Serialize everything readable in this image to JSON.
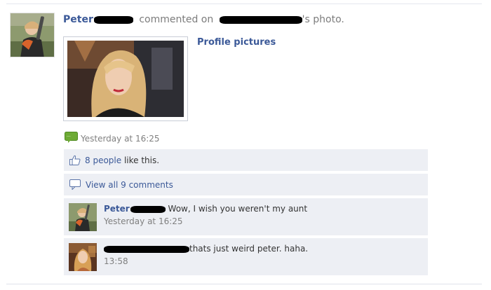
{
  "story": {
    "actor_name": "Peter",
    "verb_text": "commented on",
    "object_suffix": "'s photo.",
    "album_title": "Profile pictures",
    "timestamp": "Yesterday at 16:25",
    "source_icon": "mobile-comment-icon"
  },
  "ufi": {
    "like_count_text": "8 people",
    "like_suffix": " like this.",
    "view_comments": "View all 9 comments",
    "like_icon": "thumbs-up-icon",
    "comment_icon": "comment-bubble-icon"
  },
  "comments": [
    {
      "author": "Peter",
      "text": " Wow, I wish you weren't my aunt",
      "time": "Yesterday at 16:25"
    },
    {
      "author": "",
      "text": "thats just weird peter. haha.",
      "time": "13:58"
    }
  ],
  "colors": {
    "link": "#3b5998",
    "ufi_bg": "#edeff4",
    "meta_text": "#808080"
  }
}
